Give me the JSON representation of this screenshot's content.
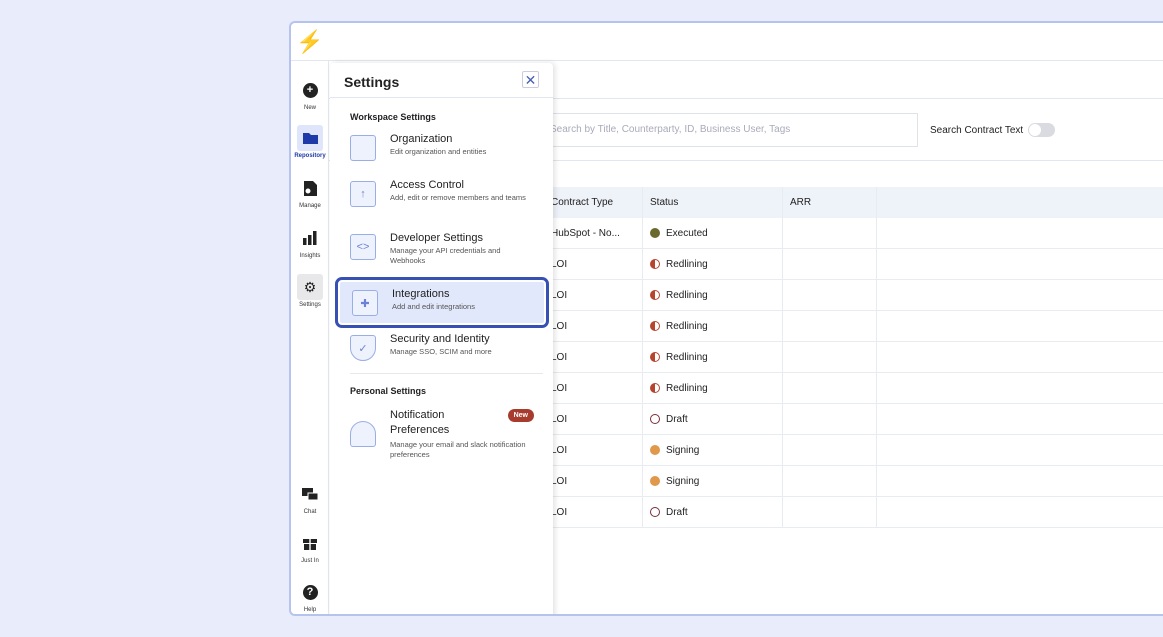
{
  "rail": {
    "items": [
      {
        "label": "New",
        "icon": "plus-circle-icon"
      },
      {
        "label": "Repository",
        "icon": "folder-icon"
      },
      {
        "label": "Manage",
        "icon": "document-gear-icon"
      },
      {
        "label": "Insights",
        "icon": "bar-chart-icon"
      },
      {
        "label": "Settings",
        "icon": "gear-icon"
      },
      {
        "label": "Chat",
        "icon": "chat-icon"
      },
      {
        "label": "Just In",
        "icon": "gift-icon"
      },
      {
        "label": "Help",
        "icon": "help-icon"
      }
    ]
  },
  "search": {
    "placeholder": "Search by Title, Counterparty, ID, Business User, Tags",
    "toggle_label": "Search Contract Text",
    "toggle_on": false
  },
  "table": {
    "headers": [
      "Contract Type",
      "Status",
      "ARR"
    ],
    "rows": [
      [
        "HubSpot - No...",
        "Executed"
      ],
      [
        "LOI",
        "Redlining"
      ],
      [
        "LOI",
        "Redlining"
      ],
      [
        "LOI",
        "Redlining"
      ],
      [
        "LOI",
        "Redlining"
      ],
      [
        "LOI",
        "Redlining"
      ],
      [
        "LOI",
        "Draft"
      ],
      [
        "LOI",
        "Signing"
      ],
      [
        "LOI",
        "Signing"
      ],
      [
        "LOI",
        "Draft"
      ]
    ]
  },
  "status_colors": {
    "Executed": "#6b6a2e",
    "Redlining": "#b5452f",
    "Draft": "#7a2e3a",
    "Signing": "#e0984a"
  },
  "settings": {
    "title": "Settings",
    "workspace_heading": "Workspace Settings",
    "personal_heading": "Personal Settings",
    "items": [
      {
        "title": "Organization",
        "desc": "Edit organization and entities"
      },
      {
        "title": "Access Control",
        "desc": "Add, edit or remove members and teams"
      },
      {
        "title": "Developer Settings",
        "desc": "Manage your API credentials and Webhooks"
      },
      {
        "title": "Integrations",
        "desc": "Add and edit integrations"
      },
      {
        "title": "Security and Identity",
        "desc": "Manage SSO, SCIM and more"
      }
    ],
    "personal": [
      {
        "title": "Notification Preferences",
        "desc": "Manage your email and slack notification preferences",
        "badge": "New"
      }
    ]
  }
}
